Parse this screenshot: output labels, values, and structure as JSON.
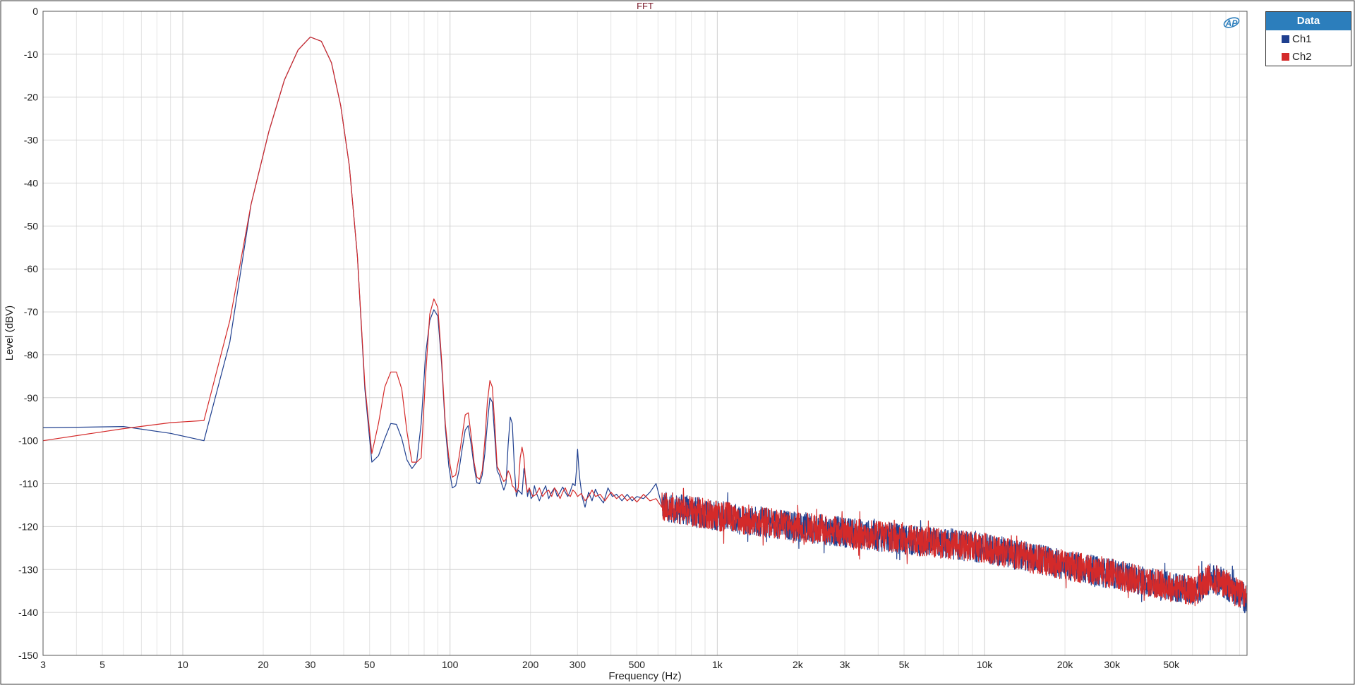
{
  "chart_data": {
    "type": "line",
    "title": "FFT",
    "xlabel": "Frequency (Hz)",
    "ylabel": "Level (dBV)",
    "x_scale": "log",
    "xlim": [
      3,
      96000
    ],
    "ylim": [
      -150,
      0
    ],
    "grid": true,
    "legend_placement": "top-right, outside plot",
    "x_ticks": [
      {
        "value": 3,
        "label": "3"
      },
      {
        "value": 5,
        "label": "5"
      },
      {
        "value": 10,
        "label": "10"
      },
      {
        "value": 20,
        "label": "20"
      },
      {
        "value": 30,
        "label": "30"
      },
      {
        "value": 50,
        "label": "50"
      },
      {
        "value": 100,
        "label": "100"
      },
      {
        "value": 200,
        "label": "200"
      },
      {
        "value": 300,
        "label": "300"
      },
      {
        "value": 500,
        "label": "500"
      },
      {
        "value": 1000,
        "label": "1k"
      },
      {
        "value": 2000,
        "label": "2k"
      },
      {
        "value": 3000,
        "label": "3k"
      },
      {
        "value": 5000,
        "label": "5k"
      },
      {
        "value": 10000,
        "label": "10k"
      },
      {
        "value": 20000,
        "label": "20k"
      },
      {
        "value": 30000,
        "label": "30k"
      },
      {
        "value": 50000,
        "label": "50k"
      }
    ],
    "y_ticks": [
      {
        "value": 0,
        "label": "0"
      },
      {
        "value": -10,
        "label": "-10"
      },
      {
        "value": -20,
        "label": "-20"
      },
      {
        "value": -30,
        "label": "-30"
      },
      {
        "value": -40,
        "label": "-40"
      },
      {
        "value": -50,
        "label": "-50"
      },
      {
        "value": -60,
        "label": "-60"
      },
      {
        "value": -70,
        "label": "-70"
      },
      {
        "value": -80,
        "label": "-80"
      },
      {
        "value": -90,
        "label": "-90"
      },
      {
        "value": -100,
        "label": "-100"
      },
      {
        "value": -110,
        "label": "-110"
      },
      {
        "value": -120,
        "label": "-120"
      },
      {
        "value": -130,
        "label": "-130"
      },
      {
        "value": -140,
        "label": "-140"
      },
      {
        "value": -150,
        "label": "-150"
      }
    ],
    "series": [
      {
        "name": "Ch1",
        "color": "#1f3f8f",
        "points": [
          [
            3,
            -97
          ],
          [
            6,
            -96.7
          ],
          [
            9,
            -98.3
          ],
          [
            12,
            -100
          ],
          [
            15,
            -77
          ],
          [
            18,
            -45
          ],
          [
            21,
            -28
          ],
          [
            24,
            -16
          ],
          [
            27,
            -9
          ],
          [
            30,
            -6
          ],
          [
            33,
            -7
          ],
          [
            36,
            -12
          ],
          [
            39,
            -22
          ],
          [
            42,
            -36
          ],
          [
            45,
            -57
          ],
          [
            48,
            -88
          ],
          [
            51,
            -105
          ],
          [
            54,
            -103.5
          ],
          [
            57,
            -99.5
          ],
          [
            60,
            -96
          ],
          [
            63,
            -96.2
          ],
          [
            66,
            -99.5
          ],
          [
            69,
            -104.5
          ],
          [
            72,
            -106.5
          ],
          [
            75,
            -105
          ],
          [
            78,
            -96
          ],
          [
            81,
            -80
          ],
          [
            84,
            -72
          ],
          [
            87,
            -69.5
          ],
          [
            90,
            -71
          ],
          [
            93,
            -82
          ],
          [
            96,
            -97
          ],
          [
            99,
            -106
          ],
          [
            102,
            -111
          ],
          [
            105,
            -110.5
          ],
          [
            108,
            -107
          ],
          [
            111,
            -102
          ],
          [
            114,
            -97.5
          ],
          [
            117,
            -96.5
          ],
          [
            120,
            -101
          ],
          [
            123,
            -106
          ],
          [
            126,
            -109.8
          ],
          [
            129,
            -110
          ],
          [
            132,
            -108
          ],
          [
            135,
            -103
          ],
          [
            138,
            -96
          ],
          [
            141,
            -90
          ],
          [
            144,
            -91
          ],
          [
            147,
            -99
          ],
          [
            150,
            -107
          ],
          [
            153,
            -108
          ],
          [
            156,
            -110
          ],
          [
            159,
            -111.5
          ],
          [
            162,
            -110
          ],
          [
            165,
            -101
          ],
          [
            168,
            -94.5
          ],
          [
            171,
            -96
          ],
          [
            174,
            -106
          ],
          [
            177,
            -113
          ],
          [
            180,
            -111.5
          ],
          [
            183,
            -112
          ],
          [
            186,
            -112.5
          ],
          [
            189,
            -106.5
          ],
          [
            192,
            -109
          ],
          [
            195,
            -113
          ],
          [
            198,
            -111
          ],
          [
            201,
            -113.5
          ],
          [
            204,
            -113
          ],
          [
            207,
            -110.5
          ],
          [
            210,
            -112
          ],
          [
            216,
            -114
          ],
          [
            222,
            -112
          ],
          [
            228,
            -110.5
          ],
          [
            234,
            -113.5
          ],
          [
            240,
            -112
          ],
          [
            246,
            -111
          ],
          [
            252,
            -113
          ],
          [
            258,
            -112
          ],
          [
            264,
            -110.8
          ],
          [
            270,
            -112
          ],
          [
            276,
            -113
          ],
          [
            282,
            -111.7
          ],
          [
            288,
            -110
          ],
          [
            294,
            -110.5
          ],
          [
            297,
            -107
          ],
          [
            300,
            -102
          ],
          [
            303,
            -106
          ],
          [
            306,
            -109
          ],
          [
            312,
            -113
          ],
          [
            320,
            -115.5
          ],
          [
            330,
            -112
          ],
          [
            340,
            -114
          ],
          [
            350,
            -111.3
          ],
          [
            360,
            -113
          ],
          [
            375,
            -114.5
          ],
          [
            390,
            -111
          ],
          [
            405,
            -113
          ],
          [
            420,
            -112.5
          ],
          [
            440,
            -114
          ],
          [
            460,
            -112.5
          ],
          [
            480,
            -114
          ],
          [
            500,
            -113
          ],
          [
            530,
            -113.5
          ],
          [
            560,
            -112
          ],
          [
            590,
            -110
          ],
          [
            620,
            -115
          ]
        ]
      },
      {
        "name": "Ch2",
        "color": "#d42a2a",
        "points": [
          [
            3,
            -100
          ],
          [
            6,
            -97.2
          ],
          [
            9,
            -95.8
          ],
          [
            12,
            -95.3
          ],
          [
            15,
            -72
          ],
          [
            18,
            -45
          ],
          [
            21,
            -28
          ],
          [
            24,
            -16
          ],
          [
            27,
            -9
          ],
          [
            30,
            -6
          ],
          [
            33,
            -7
          ],
          [
            36,
            -12
          ],
          [
            39,
            -22
          ],
          [
            42,
            -36
          ],
          [
            45,
            -57
          ],
          [
            48,
            -87
          ],
          [
            51,
            -103
          ],
          [
            54,
            -96
          ],
          [
            57,
            -87.5
          ],
          [
            60,
            -84
          ],
          [
            63,
            -84
          ],
          [
            66,
            -88
          ],
          [
            69,
            -98
          ],
          [
            72,
            -105
          ],
          [
            75,
            -105
          ],
          [
            78,
            -104
          ],
          [
            81,
            -85
          ],
          [
            84,
            -70.5
          ],
          [
            87,
            -67
          ],
          [
            90,
            -69
          ],
          [
            93,
            -81
          ],
          [
            96,
            -96
          ],
          [
            99,
            -104
          ],
          [
            102,
            -108.5
          ],
          [
            105,
            -108
          ],
          [
            108,
            -104
          ],
          [
            111,
            -99
          ],
          [
            114,
            -94
          ],
          [
            117,
            -93.5
          ],
          [
            120,
            -99
          ],
          [
            123,
            -105
          ],
          [
            126,
            -108.5
          ],
          [
            129,
            -109
          ],
          [
            132,
            -107
          ],
          [
            135,
            -100
          ],
          [
            138,
            -91
          ],
          [
            141,
            -86
          ],
          [
            144,
            -87.5
          ],
          [
            147,
            -96
          ],
          [
            150,
            -106
          ],
          [
            153,
            -107
          ],
          [
            156,
            -108.5
          ],
          [
            159,
            -109.5
          ],
          [
            162,
            -109
          ],
          [
            165,
            -107
          ],
          [
            168,
            -108
          ],
          [
            171,
            -110.5
          ],
          [
            174,
            -111
          ],
          [
            177,
            -112
          ],
          [
            180,
            -111
          ],
          [
            183,
            -104
          ],
          [
            186,
            -101.5
          ],
          [
            189,
            -104
          ],
          [
            192,
            -110
          ],
          [
            195,
            -112
          ],
          [
            198,
            -111
          ],
          [
            204,
            -113
          ],
          [
            210,
            -112.5
          ],
          [
            216,
            -111
          ],
          [
            222,
            -113
          ],
          [
            228,
            -112
          ],
          [
            234,
            -111.5
          ],
          [
            240,
            -113
          ],
          [
            246,
            -111
          ],
          [
            252,
            -112
          ],
          [
            258,
            -113.5
          ],
          [
            264,
            -112
          ],
          [
            270,
            -111
          ],
          [
            276,
            -112.5
          ],
          [
            282,
            -113
          ],
          [
            288,
            -111.5
          ],
          [
            294,
            -112
          ],
          [
            300,
            -113
          ],
          [
            310,
            -112.3
          ],
          [
            320,
            -114
          ],
          [
            330,
            -113
          ],
          [
            340,
            -111.5
          ],
          [
            350,
            -113
          ],
          [
            365,
            -112.5
          ],
          [
            380,
            -114
          ],
          [
            400,
            -112
          ],
          [
            420,
            -113.5
          ],
          [
            440,
            -112.5
          ],
          [
            460,
            -114
          ],
          [
            480,
            -113
          ],
          [
            500,
            -114.3
          ],
          [
            530,
            -112.5
          ],
          [
            560,
            -114
          ],
          [
            590,
            -113.5
          ],
          [
            620,
            -115.5
          ]
        ]
      }
    ],
    "noise_floor_trend": {
      "note": "dense FFT noise above ~600 Hz, both channels overlapping",
      "x": [
        600,
        1000,
        2000,
        5000,
        10000,
        20000,
        30000,
        50000,
        62000,
        70000,
        80000,
        96000
      ],
      "y": [
        -115,
        -117.5,
        -120,
        -123,
        -125,
        -129,
        -131,
        -134,
        -135,
        -132,
        -133.5,
        -137
      ],
      "spread_db": 3.5
    }
  },
  "legend": {
    "header": "Data",
    "items": [
      {
        "label": "Ch1",
        "color": "#1f3f8f"
      },
      {
        "label": "Ch2",
        "color": "#d42a2a"
      }
    ]
  },
  "logo_text": "AP"
}
